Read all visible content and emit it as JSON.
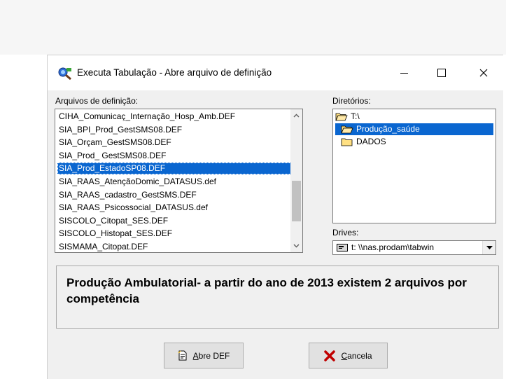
{
  "window": {
    "title": "Executa Tabulação - Abre arquivo de definição",
    "controls": {
      "minimize": "—",
      "maximize": "☐",
      "close": "✕"
    }
  },
  "files": {
    "label": "Arquivos de definição:",
    "items": [
      "CIHA_Comunicaç_Internação_Hosp_Amb.DEF",
      "SIA_BPI_Prod_GestSMS08.DEF",
      "SIA_Orçam_GestSMS08.DEF",
      "SIA_Prod_ GestSMS08.DEF",
      "SIA_Prod_EstadoSP08.DEF",
      "SIA_RAAS_AtençãoDomic_DATASUS.def",
      "SIA_RAAS_cadastro_GestSMS.DEF",
      "SIA_RAAS_Psicossocial_DATASUS.def",
      "SISCOLO_Citopat_SES.DEF",
      "SISCOLO_Histopat_SES.DEF",
      "SISMAMA_Citopat.DEF"
    ],
    "selected_index": 4,
    "scroll_position": 0.72
  },
  "directories": {
    "label": "Diretórios:",
    "items": [
      {
        "name": "T:\\",
        "icon": "open-folder-icon"
      },
      {
        "name": "Produção_saúde",
        "icon": "open-folder-icon"
      },
      {
        "name": "DADOS",
        "icon": "folder-icon"
      }
    ],
    "selected_index": 1
  },
  "drives": {
    "label": "Drives:",
    "value": "t: \\\\nas.prodam\\tabwin",
    "icon": "network-drive-icon"
  },
  "description": "Produção Ambulatorial- a partir do ano de 2013 existem 2 arquivos por competência",
  "buttons": {
    "open": {
      "accel": "A",
      "rest": "bre DEF",
      "icon": "document-open-icon"
    },
    "cancel": {
      "accel": "C",
      "rest": "ancela",
      "icon": "red-x-icon"
    }
  },
  "colors": {
    "selection": "#0a66d0",
    "window_bg": "#f0f0f0",
    "folder": "#ffe082"
  }
}
